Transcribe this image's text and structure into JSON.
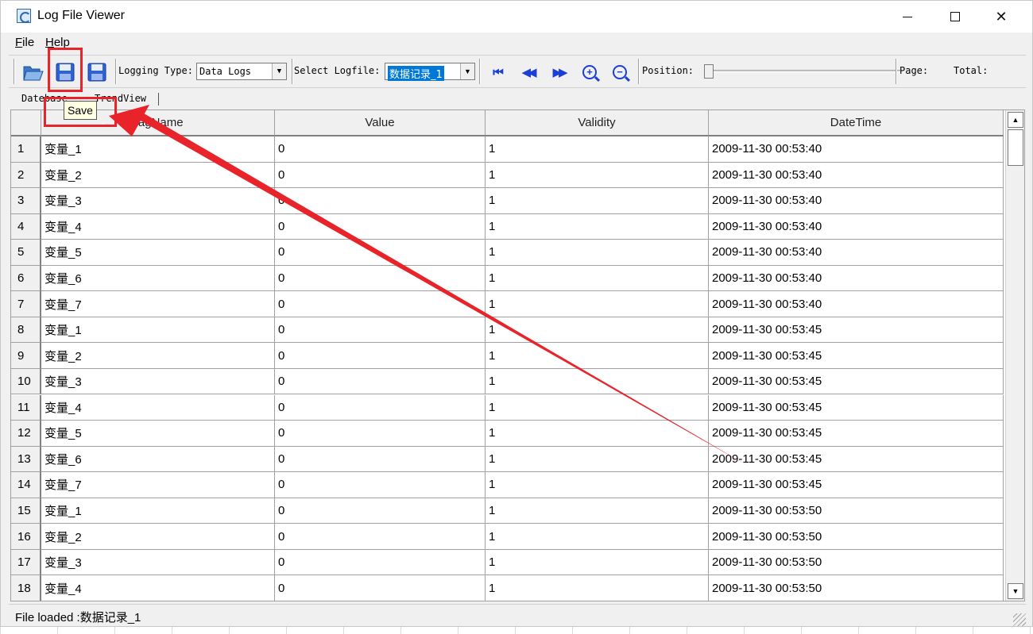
{
  "window": {
    "title": "Log File Viewer"
  },
  "menu": {
    "file": "File",
    "help": "Help"
  },
  "toolbar": {
    "logging_type_label": "Logging Type:",
    "logging_type_value": "Data Logs",
    "select_logfile_label": "Select Logfile:",
    "select_logfile_value": "数据记录_1",
    "position_label": "Position:",
    "page_label": "Page:",
    "total_label": "Total:",
    "buttons": [
      "open-icon",
      "save-icon",
      "save-as-icon",
      "first-icon",
      "previous-icon",
      "next-icon",
      "zoom-in-icon",
      "zoom-out-icon"
    ]
  },
  "tabs": {
    "database": "Datebase",
    "trendview": "TrendView"
  },
  "tooltip": "Save",
  "table": {
    "columns": [
      "TagName",
      "Value",
      "Validity",
      "DateTime"
    ],
    "rows": [
      {
        "n": "1",
        "tag": "变量_1",
        "value": "0",
        "validity": "1",
        "time": "2009-11-30 00:53:40"
      },
      {
        "n": "2",
        "tag": "变量_2",
        "value": "0",
        "validity": "1",
        "time": "2009-11-30 00:53:40"
      },
      {
        "n": "3",
        "tag": "变量_3",
        "value": "0",
        "validity": "1",
        "time": "2009-11-30 00:53:40"
      },
      {
        "n": "4",
        "tag": "变量_4",
        "value": "0",
        "validity": "1",
        "time": "2009-11-30 00:53:40"
      },
      {
        "n": "5",
        "tag": "变量_5",
        "value": "0",
        "validity": "1",
        "time": "2009-11-30 00:53:40"
      },
      {
        "n": "6",
        "tag": "变量_6",
        "value": "0",
        "validity": "1",
        "time": "2009-11-30 00:53:40"
      },
      {
        "n": "7",
        "tag": "变量_7",
        "value": "0",
        "validity": "1",
        "time": "2009-11-30 00:53:40"
      },
      {
        "n": "8",
        "tag": "变量_1",
        "value": "0",
        "validity": "1",
        "time": "2009-11-30 00:53:45"
      },
      {
        "n": "9",
        "tag": "变量_2",
        "value": "0",
        "validity": "1",
        "time": "2009-11-30 00:53:45"
      },
      {
        "n": "10",
        "tag": "变量_3",
        "value": "0",
        "validity": "1",
        "time": "2009-11-30 00:53:45"
      },
      {
        "n": "11",
        "tag": "变量_4",
        "value": "0",
        "validity": "1",
        "time": "2009-11-30 00:53:45"
      },
      {
        "n": "12",
        "tag": "变量_5",
        "value": "0",
        "validity": "1",
        "time": "2009-11-30 00:53:45"
      },
      {
        "n": "13",
        "tag": "变量_6",
        "value": "0",
        "validity": "1",
        "time": "2009-11-30 00:53:45"
      },
      {
        "n": "14",
        "tag": "变量_7",
        "value": "0",
        "validity": "1",
        "time": "2009-11-30 00:53:45"
      },
      {
        "n": "15",
        "tag": "变量_1",
        "value": "0",
        "validity": "1",
        "time": "2009-11-30 00:53:50"
      },
      {
        "n": "16",
        "tag": "变量_2",
        "value": "0",
        "validity": "1",
        "time": "2009-11-30 00:53:50"
      },
      {
        "n": "17",
        "tag": "变量_3",
        "value": "0",
        "validity": "1",
        "time": "2009-11-30 00:53:50"
      },
      {
        "n": "18",
        "tag": "变量_4",
        "value": "0",
        "validity": "1",
        "time": "2009-11-30 00:53:50"
      }
    ]
  },
  "status": {
    "text": "File loaded :数据记录_1"
  },
  "colors": {
    "annotation": "#e8232a",
    "icon_blue": "#1a3fd6",
    "selection": "#0078d7"
  }
}
